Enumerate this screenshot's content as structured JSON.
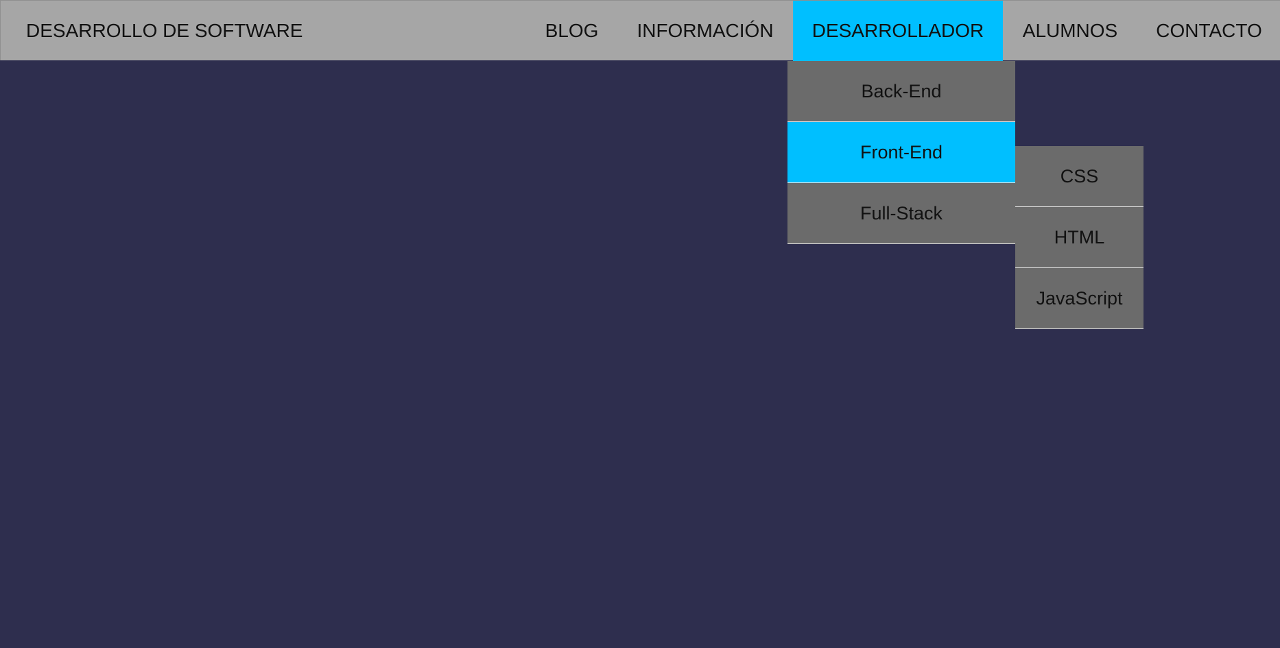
{
  "header": {
    "brand": "DESARROLLO DE SOFTWARE"
  },
  "nav": {
    "items": [
      {
        "label": "BLOG"
      },
      {
        "label": "INFORMACIÓN"
      },
      {
        "label": "DESARROLLADOR"
      },
      {
        "label": "ALUMNOS"
      },
      {
        "label": "CONTACTO"
      }
    ],
    "active": "DESARROLLADOR"
  },
  "dropdown": {
    "items": [
      {
        "label": "Back-End"
      },
      {
        "label": "Front-End"
      },
      {
        "label": "Full-Stack"
      }
    ],
    "active": "Front-End"
  },
  "submenu": {
    "items": [
      {
        "label": "CSS"
      },
      {
        "label": "HTML"
      },
      {
        "label": "JavaScript"
      }
    ]
  },
  "colors": {
    "background": "#2e2e4e",
    "navbar": "#a6a6a6",
    "menu": "#6b6b6b",
    "accent": "#00bfff"
  }
}
